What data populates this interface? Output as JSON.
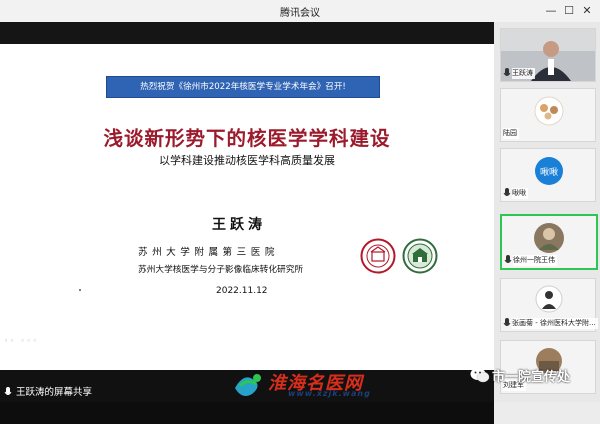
{
  "window": {
    "title": "腾讯会议",
    "minimize": "—",
    "maximize": "☐",
    "close": "✕"
  },
  "slide": {
    "banner": "热烈祝贺《徐州市2022年核医学专业学术年会》召开!",
    "title": "浅谈新形势下的核医学学科建设",
    "subtitle": "以学科建设推动核医学科高质量发展",
    "author": "王跃涛",
    "affiliation_1": "苏州大学附属第三医院",
    "affiliation_2": "苏州大学核医学与分子影像临床转化研究所",
    "date": "2022.11.12",
    "scroll_dots": "◦◦ ◦◦◦"
  },
  "share_bar": {
    "label": "王跃涛的屏幕共享"
  },
  "participants": [
    {
      "name": "王跃涛",
      "has_mic": true,
      "active": false
    },
    {
      "name": "陆园",
      "has_mic": false,
      "active": false
    },
    {
      "name": "啾啾",
      "has_mic": true,
      "active": false,
      "avatar_text": "啾啾"
    },
    {
      "name": "徐州一院王伟",
      "has_mic": true,
      "active": true
    },
    {
      "name": "张画菊 - 徐州医科大学附...",
      "has_mic": true,
      "active": false
    },
    {
      "name": "刘建军",
      "has_mic": false,
      "active": false
    }
  ],
  "watermark": {
    "text": "淮海名医网",
    "url": "www.xzjk.wang"
  },
  "wechat_overlay": {
    "text": "市一院宣传处"
  },
  "colors": {
    "title_red": "#9b1a2c",
    "banner_blue": "#2f63b3",
    "active_green": "#2dc653",
    "watermark_red": "#d72e1c"
  }
}
